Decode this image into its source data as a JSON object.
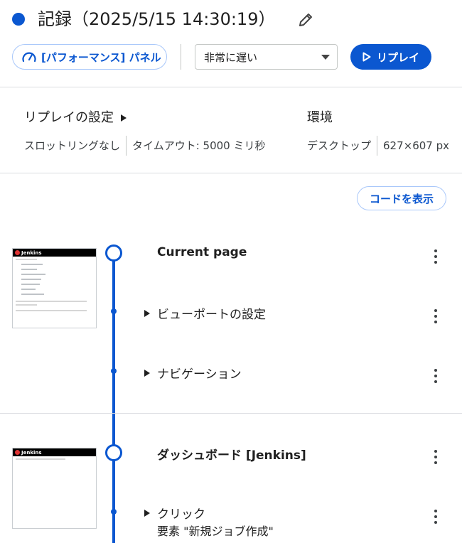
{
  "header": {
    "title": "記録（2025/5/15 14:30:19）",
    "performance_panel_label": "[パフォーマンス] パネル",
    "throttle_select_value": "非常に遅い",
    "replay_label": "リプレイ"
  },
  "replay_settings": {
    "heading": "リプレイの設定",
    "throttling": "スロットリングなし",
    "timeout": "タイムアウト: 5000 ミリ秒"
  },
  "environment": {
    "heading": "環境",
    "device": "デスクトップ",
    "size": "627×607 px"
  },
  "show_code_label": "コードを表示",
  "sections": [
    {
      "title": "Current page",
      "thumb_brand": "Jenkins",
      "steps": [
        {
          "label": "ビューポートの設定"
        },
        {
          "label": "ナビゲーション"
        }
      ]
    },
    {
      "title": "ダッシュボード [Jenkins]",
      "thumb_brand": "Jenkins",
      "steps": [
        {
          "label": "クリック",
          "detail": "要素 \"新規ジョブ作成\""
        }
      ]
    }
  ],
  "colors": {
    "accent": "#0b57d0",
    "divider": "#dadce0"
  },
  "icons": {
    "recording": "recording-dot-icon",
    "edit": "pencil-icon",
    "performance": "gauge-icon",
    "play": "play-icon",
    "expand": "triangle-right-icon",
    "menu": "kebab-menu-icon"
  }
}
